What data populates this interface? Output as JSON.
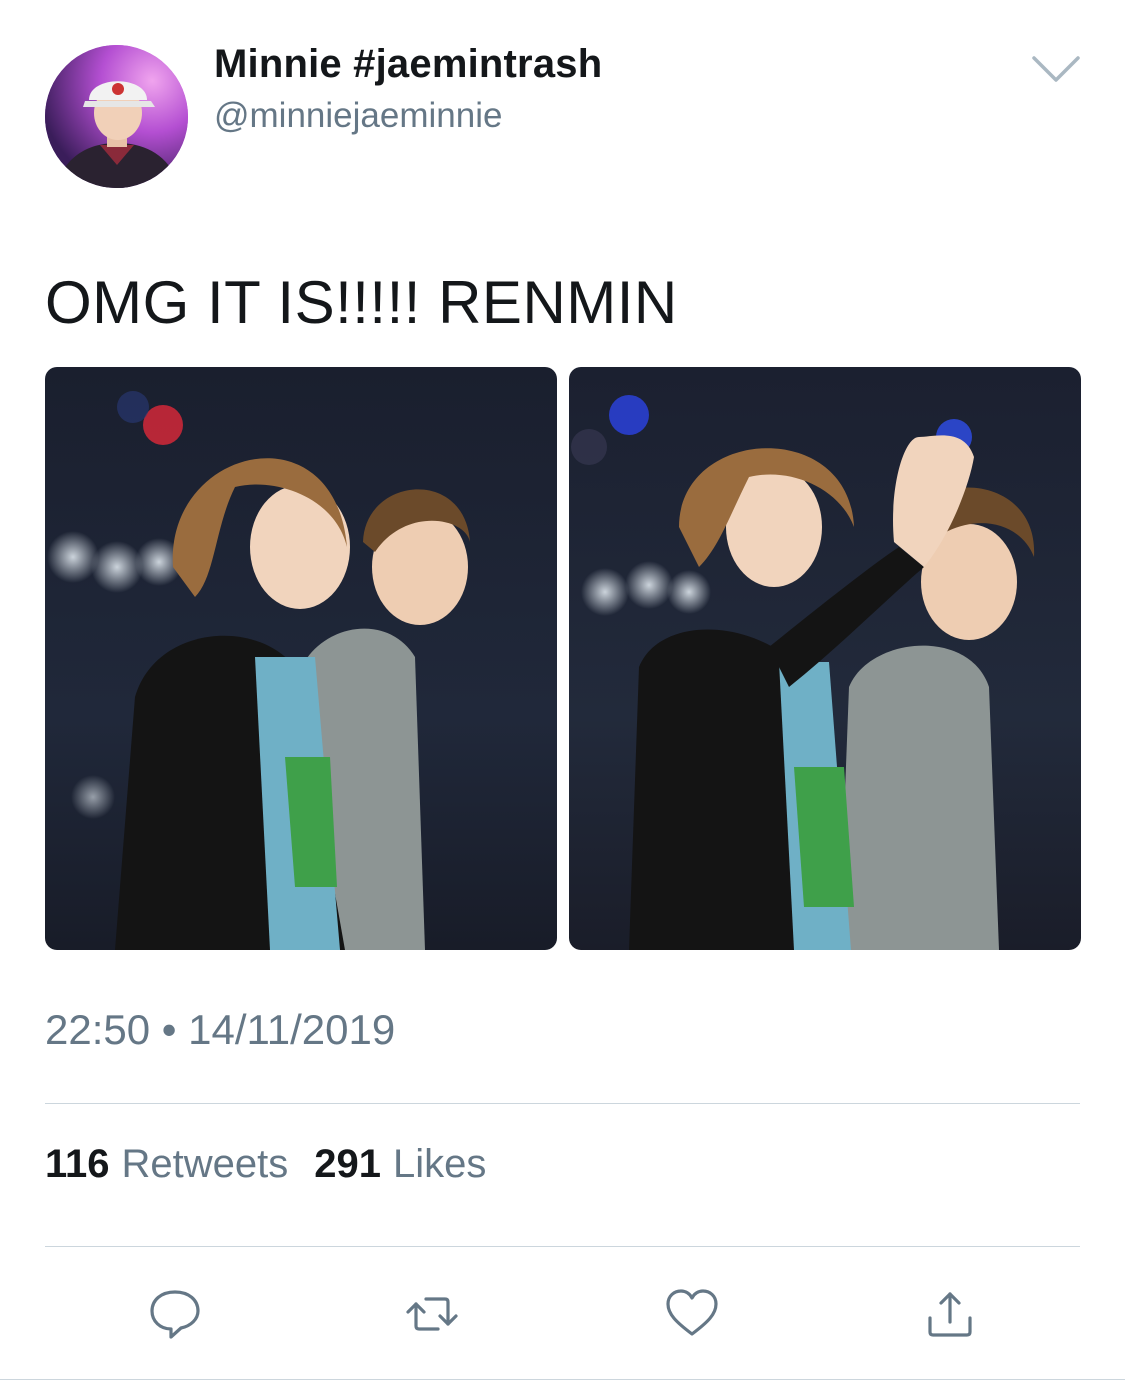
{
  "user": {
    "display_name": "Minnie #jaemintrash",
    "handle": "@minniejaeminnie"
  },
  "tweet": {
    "text": "OMG IT IS!!!!! RENMIN",
    "timestamp": "22:50 • 14/11/2019"
  },
  "media": [
    {
      "description_icon": "photo"
    },
    {
      "description_icon": "photo"
    }
  ],
  "stats": {
    "retweets_count": "116",
    "retweets_label": "Retweets",
    "likes_count": "291",
    "likes_label": "Likes"
  },
  "icons": {
    "more": "chevron-down-icon",
    "reply": "reply-icon",
    "retweet": "retweet-icon",
    "like": "heart-icon",
    "share": "share-icon"
  },
  "colors": {
    "primary_text": "#14171a",
    "secondary_text": "#657786",
    "divider": "#ccd6dd",
    "icon": "#657786"
  }
}
